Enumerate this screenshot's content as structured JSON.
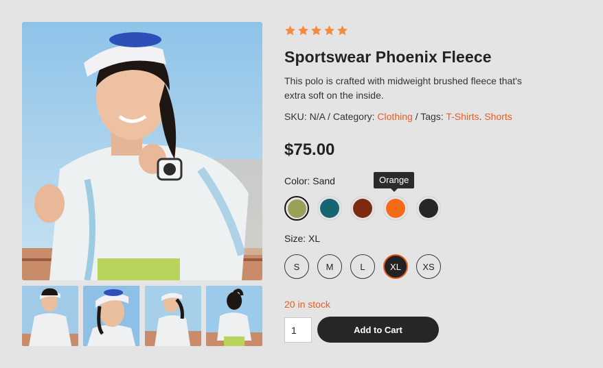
{
  "product": {
    "rating_stars": 5,
    "title": "Sportswear Phoenix Fleece",
    "description": "This polo is crafted with midweight brushed fleece that's extra soft on the inside.",
    "sku_label": "SKU:",
    "sku_value": "N/A",
    "category_label": "Category:",
    "category": "Clothing",
    "tags_label": "Tags:",
    "tags": [
      "T-Shirts",
      "Shorts"
    ],
    "price": "$75.00"
  },
  "color": {
    "label": "Color: Sand",
    "tooltip": "Orange",
    "swatches": [
      {
        "name": "Sand",
        "hex": "#9aa058",
        "selected": true
      },
      {
        "name": "Teal",
        "hex": "#156672"
      },
      {
        "name": "Rust",
        "hex": "#7e2a12"
      },
      {
        "name": "Orange",
        "hex": "#f56a17"
      },
      {
        "name": "Black",
        "hex": "#262626"
      }
    ]
  },
  "size": {
    "label": "Size: XL",
    "options": [
      "S",
      "M",
      "L",
      "XL",
      "XS"
    ],
    "selected": "XL"
  },
  "stock": "20 in stock",
  "quantity": "1",
  "add_to_cart": "Add to Cart",
  "colors": {
    "accent": "#e85d22",
    "star": "#f58a3d",
    "button": "#262626"
  },
  "gallery": {
    "main_image": "woman-in-visor-sportswear",
    "thumbnails": [
      "front-view",
      "smiling-close-up",
      "side-view",
      "back-view"
    ]
  }
}
